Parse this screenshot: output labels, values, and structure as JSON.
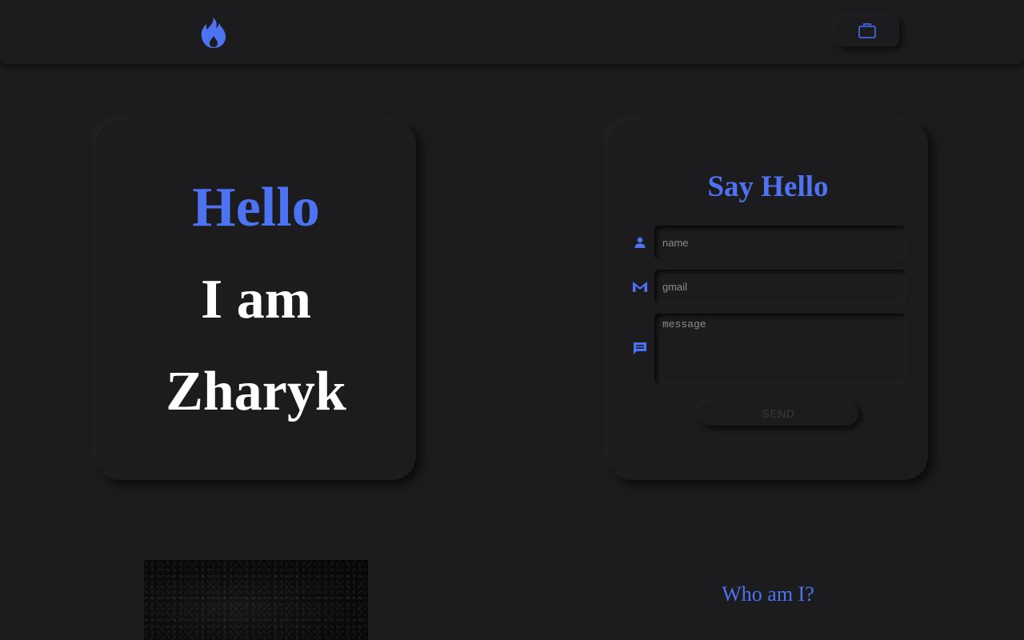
{
  "colors": {
    "background": "#1c1c1e",
    "accent": "#4d73f2",
    "text": "#ffffff"
  },
  "navbar": {
    "logo_icon": "flame-icon",
    "portfolio_icon": "briefcase-icon"
  },
  "intro": {
    "line1": "Hello",
    "line2": "I am",
    "line3": "Zharyk"
  },
  "contact_form": {
    "title": "Say Hello",
    "name_icon": "person-icon",
    "name_placeholder": "name",
    "name_value": "",
    "gmail_icon": "gmail-icon",
    "gmail_placeholder": "gmail",
    "gmail_value": "",
    "message_icon": "message-icon",
    "message_placeholder": "message",
    "message_value": "",
    "send_label": "SEND"
  },
  "about": {
    "heading": "Who am I?"
  }
}
